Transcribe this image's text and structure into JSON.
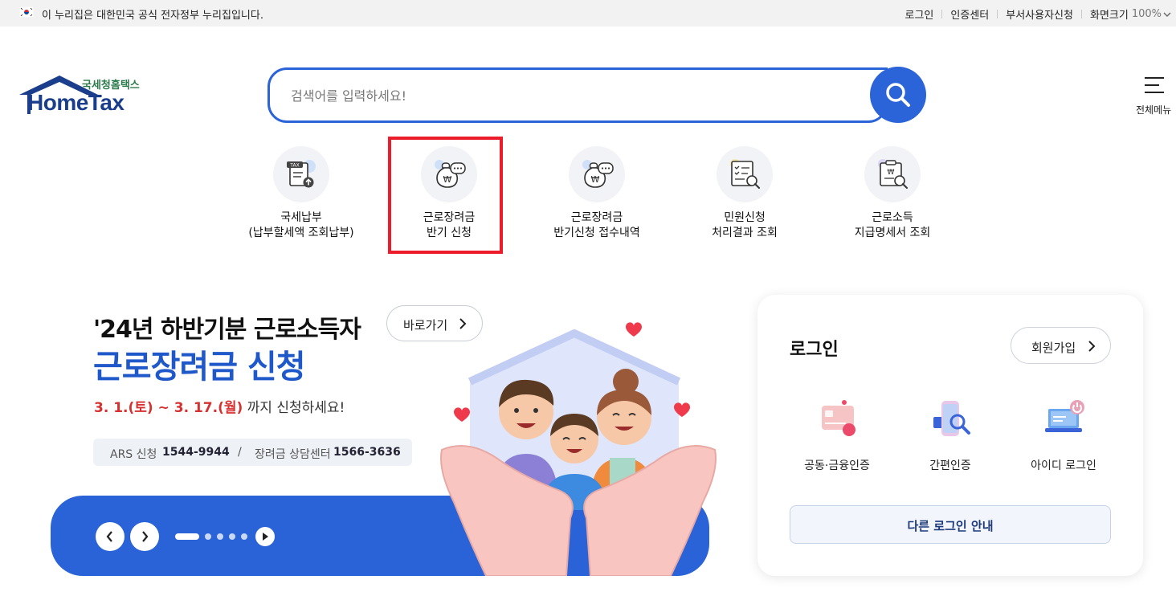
{
  "gov_bar": {
    "notice": "이 누리집은 대한민국 공식 전자정부 누리집입니다.",
    "links": [
      "로그인",
      "인증센터",
      "부서사용자신청",
      "화면크기"
    ],
    "zoom_value": "100%",
    "flag_icon": "korea-flag-icon"
  },
  "logo": {
    "korean": "국세청홈택스",
    "english": "HomeTax"
  },
  "search": {
    "placeholder": "검색어를 입력하세요!",
    "button_icon": "search-icon"
  },
  "all_menu": {
    "label": "전체메뉴",
    "icon": "hamburger-icon"
  },
  "quick_menu": [
    {
      "line1": "국세납부",
      "line2": "(납부할세액 조회납부)",
      "icon": "tax-upload-icon"
    },
    {
      "line1": "근로장려금",
      "line2": "반기 신청",
      "icon": "money-bag-chat-icon",
      "highlighted": true
    },
    {
      "line1": "근로장려금",
      "line2": "반기신청 접수내역",
      "icon": "money-bag-chat-icon"
    },
    {
      "line1": "민원신청",
      "line2": "처리결과 조회",
      "icon": "document-search-icon"
    },
    {
      "line1": "근로소득",
      "line2": "지급명세서 조회",
      "icon": "clipboard-search-icon"
    }
  ],
  "banner": {
    "line1": "'24년 하반기분 근로소득자",
    "line2": "근로장려금 신청",
    "goto_label": "바로가기",
    "period_red": "3. 1.(토) ~ 3. 17.(월)",
    "period_rest": " 까지 신청하세요!",
    "ars_label": "ARS 신청",
    "ars_number": "1544-9944",
    "separator": "/",
    "center_label": "장려금 상담센터",
    "center_number": "1566-3636",
    "slides_total": 5,
    "slide_current": 1
  },
  "login": {
    "title": "로그인",
    "join_label": "회원가입",
    "options": [
      {
        "label": "공동·금융인증",
        "icon": "certificate-card-icon"
      },
      {
        "label": "간편인증",
        "icon": "phone-search-icon"
      },
      {
        "label": "아이디 로그인",
        "icon": "laptop-power-icon"
      }
    ],
    "other_label": "다른 로그인 안내"
  },
  "colors": {
    "brand_blue": "#2b63d8",
    "highlight_red": "#ec1c2a",
    "period_red": "#d63131"
  }
}
